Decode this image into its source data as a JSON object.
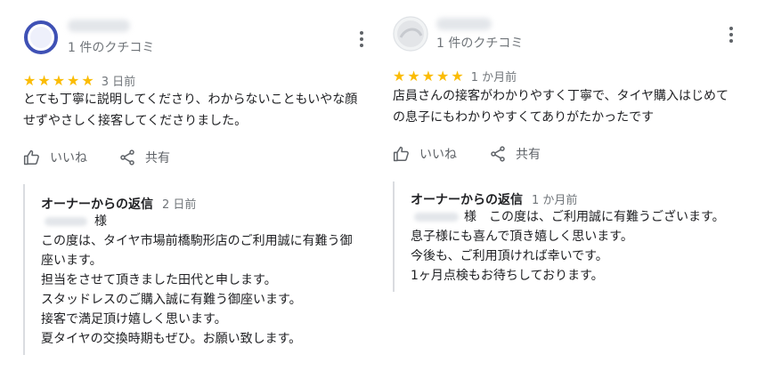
{
  "review_left": {
    "review_count": "1 件のクチコミ",
    "rating": 5,
    "date": "3 日前",
    "text_lines": [
      "とても丁寧に説明してくださり、わからないこともいやな顔",
      "せずやさしく接客してくださりました。"
    ],
    "like_label": "いいね",
    "share_label": "共有",
    "reply": {
      "title": "オーナーからの返信",
      "date": "2 日前",
      "salutation": "様",
      "lines": [
        "この度は、タイヤ市場前橋駒形店のご利用誠に有難う御",
        "座います。",
        "担当をさせて頂きました田代と申します。",
        "スタッドレスのご購入誠に有難う御座います。",
        "接客で満足頂け嬉しく思います。",
        "夏タイヤの交換時期もぜひ。お願い致します。"
      ]
    }
  },
  "review_right": {
    "review_count": "1 件のクチコミ",
    "rating": 5,
    "date": "1 か月前",
    "text_lines": [
      "店員さんの接客がわかりやすく丁寧で、タイヤ購入はじめて",
      "の息子にもわかりやすくてありがたかったです"
    ],
    "like_label": "いいね",
    "share_label": "共有",
    "reply": {
      "title": "オーナーからの返信",
      "date": "1 か月前",
      "first_line_suffix": "様　この度は、ご利用誠に有難うございます。",
      "lines": [
        "息子様にも喜んで頂き嬉しく思います。",
        "今後も、ご利用頂ければ幸いです。",
        "1ヶ月点検もお待ちしております。"
      ]
    }
  },
  "colors": {
    "star": "#fbbc04",
    "text": "#202124",
    "secondary_text": "#70757a",
    "icon": "#5f6368",
    "divider": "#dadce0"
  }
}
